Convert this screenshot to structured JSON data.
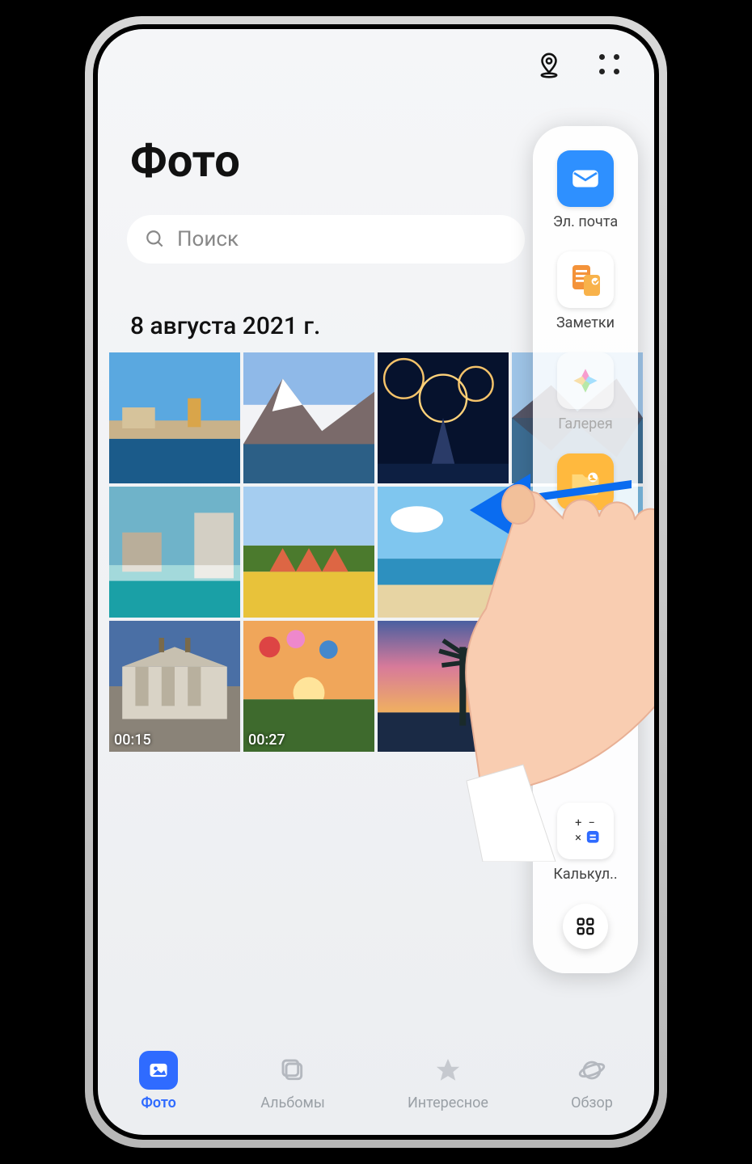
{
  "header": {
    "title": "Фото"
  },
  "search": {
    "placeholder": "Поиск"
  },
  "section": {
    "date": "8 августа 2021 г."
  },
  "photos": {
    "items": [
      {
        "kind": "town-coast"
      },
      {
        "kind": "mountain-lake"
      },
      {
        "kind": "fireworks-castle"
      },
      {
        "kind": "lake-reflection"
      },
      {
        "kind": "city-waterfall"
      },
      {
        "kind": "flower-field"
      },
      {
        "kind": "beach"
      },
      {
        "kind": "bay-town"
      },
      {
        "kind": "monument",
        "duration": "00:15"
      },
      {
        "kind": "balloons-sunset",
        "duration": "00:27"
      },
      {
        "kind": "palm-sunset"
      }
    ]
  },
  "dock": {
    "items": [
      {
        "id": "mail",
        "label": "Эл. почта"
      },
      {
        "id": "notes",
        "label": "Заметки"
      },
      {
        "id": "gallery",
        "label": "Галерея",
        "dim": true
      },
      {
        "id": "files",
        "label": ""
      },
      {
        "id": "calc",
        "label": "Калькул.."
      }
    ]
  },
  "nav": {
    "items": [
      {
        "id": "photos",
        "label": "Фото",
        "active": true
      },
      {
        "id": "albums",
        "label": "Альбомы"
      },
      {
        "id": "highlights",
        "label": "Интересное"
      },
      {
        "id": "discover",
        "label": "Обзор"
      }
    ]
  }
}
